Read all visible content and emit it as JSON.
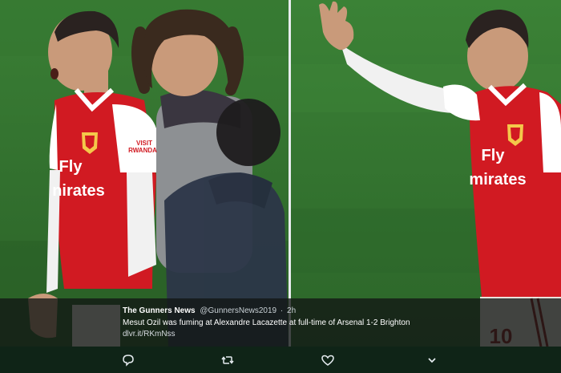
{
  "tweet": {
    "author_name": "The Gunners News",
    "author_handle": "@GunnersNews2019",
    "separator": "·",
    "time": "2h",
    "text": "Mesut Ozil was fuming at Alexandre Lacazette at full-time of Arsenal 1-2 Brighton",
    "link": "dlvr.it/RKmNss"
  },
  "photo_left": {
    "sleeve_text_line1": "VISIT",
    "sleeve_text_line2": "RWANDA",
    "shirt_text_line1": "Fly",
    "shirt_text_line2": "nirates"
  },
  "photo_right": {
    "shirt_text_line1": "Fly",
    "shirt_text_line2": "mirates",
    "shorts_number": "10"
  },
  "actions": {
    "reply_icon": "speech-bubble",
    "retweet_icon": "two-arrows-loop",
    "like_icon": "heart-outline",
    "more_icon": "chevron-down"
  },
  "colors": {
    "pitch": "#2f6b2c",
    "arsenal_red": "#d11a22",
    "action_bar": "#0f2417",
    "caption_overlay": "rgba(18,22,20,0.78)"
  }
}
